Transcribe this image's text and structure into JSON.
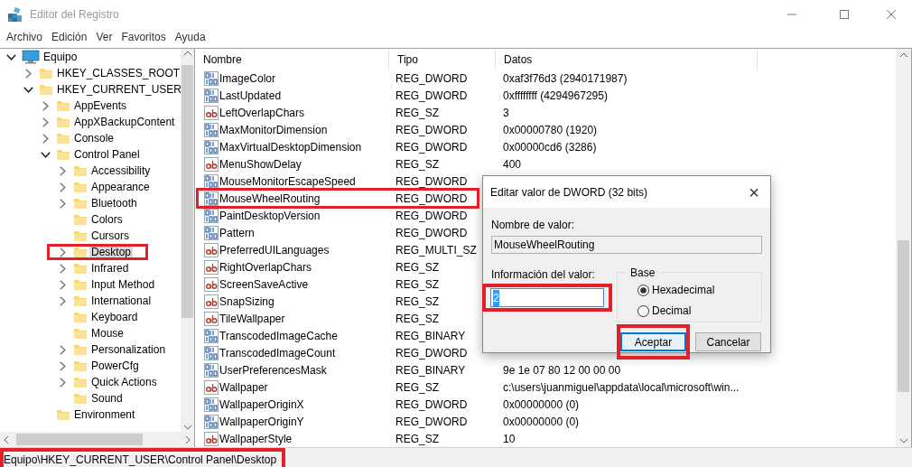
{
  "window": {
    "title": "Editor del Registro"
  },
  "menu": [
    "Archivo",
    "Edición",
    "Ver",
    "Favoritos",
    "Ayuda"
  ],
  "tree": [
    {
      "label": "Equipo",
      "kind": "computer",
      "expanded": true,
      "selected": false,
      "children": [
        {
          "label": "HKEY_CLASSES_ROOT",
          "kind": "branch",
          "expanded": false,
          "selected": false
        },
        {
          "label": "HKEY_CURRENT_USER",
          "kind": "branch",
          "expanded": true,
          "selected": false,
          "children": [
            {
              "label": "AppEvents",
              "kind": "branch",
              "expanded": false,
              "selected": false
            },
            {
              "label": "AppXBackupContent",
              "kind": "branch",
              "expanded": false,
              "selected": false
            },
            {
              "label": "Console",
              "kind": "branch",
              "expanded": false,
              "selected": false
            },
            {
              "label": "Control Panel",
              "kind": "branch",
              "expanded": true,
              "selected": false,
              "children": [
                {
                  "label": "Accessibility",
                  "kind": "branch",
                  "expanded": false,
                  "selected": false
                },
                {
                  "label": "Appearance",
                  "kind": "branch",
                  "expanded": false,
                  "selected": false
                },
                {
                  "label": "Bluetooth",
                  "kind": "branch",
                  "expanded": false,
                  "selected": false
                },
                {
                  "label": "Colors",
                  "kind": "leaf",
                  "selected": false
                },
                {
                  "label": "Cursors",
                  "kind": "leaf",
                  "selected": false
                },
                {
                  "label": "Desktop",
                  "kind": "branch",
                  "expanded": false,
                  "selected": true
                },
                {
                  "label": "Infrared",
                  "kind": "branch",
                  "expanded": false,
                  "selected": false
                },
                {
                  "label": "Input Method",
                  "kind": "branch",
                  "expanded": false,
                  "selected": false
                },
                {
                  "label": "International",
                  "kind": "branch",
                  "expanded": false,
                  "selected": false
                },
                {
                  "label": "Keyboard",
                  "kind": "leaf",
                  "selected": false
                },
                {
                  "label": "Mouse",
                  "kind": "leaf",
                  "selected": false
                },
                {
                  "label": "Personalization",
                  "kind": "branch",
                  "expanded": false,
                  "selected": false
                },
                {
                  "label": "PowerCfg",
                  "kind": "branch",
                  "expanded": false,
                  "selected": false
                },
                {
                  "label": "Quick Actions",
                  "kind": "branch",
                  "expanded": false,
                  "selected": false
                },
                {
                  "label": "Sound",
                  "kind": "leaf",
                  "selected": false
                }
              ]
            },
            {
              "label": "Environment",
              "kind": "leaf",
              "selected": false
            }
          ]
        }
      ]
    }
  ],
  "list": {
    "columns": [
      "Nombre",
      "Tipo",
      "Datos"
    ],
    "rows": [
      {
        "name": "ImageColor",
        "kind": "binary",
        "type": "REG_DWORD",
        "data": "0xaf3f76d3 (2940171987)"
      },
      {
        "name": "LastUpdated",
        "kind": "binary",
        "type": "REG_DWORD",
        "data": "0xffffffff (4294967295)"
      },
      {
        "name": "LeftOverlapChars",
        "kind": "string",
        "type": "REG_SZ",
        "data": "3"
      },
      {
        "name": "MaxMonitorDimension",
        "kind": "binary",
        "type": "REG_DWORD",
        "data": "0x00000780 (1920)"
      },
      {
        "name": "MaxVirtualDesktopDimension",
        "kind": "binary",
        "type": "REG_DWORD",
        "data": "0x00000cd6 (3286)"
      },
      {
        "name": "MenuShowDelay",
        "kind": "string",
        "type": "REG_SZ",
        "data": "400"
      },
      {
        "name": "MouseMonitorEscapeSpeed",
        "kind": "binary",
        "type": "REG_DWORD"
      },
      {
        "name": "MouseWheelRouting",
        "kind": "binary",
        "type": "REG_DWORD"
      },
      {
        "name": "PaintDesktopVersion",
        "kind": "binary",
        "type": "REG_DWORD"
      },
      {
        "name": "Pattern",
        "kind": "binary",
        "type": "REG_DWORD"
      },
      {
        "name": "PreferredUILanguages",
        "kind": "string",
        "type": "REG_MULTI_SZ"
      },
      {
        "name": "RightOverlapChars",
        "kind": "string",
        "type": "REG_SZ"
      },
      {
        "name": "ScreenSaveActive",
        "kind": "string",
        "type": "REG_SZ"
      },
      {
        "name": "SnapSizing",
        "kind": "string",
        "type": "REG_SZ"
      },
      {
        "name": "TileWallpaper",
        "kind": "string",
        "type": "REG_SZ"
      },
      {
        "name": "TranscodedImageCache",
        "kind": "binary",
        "type": "REG_BINARY"
      },
      {
        "name": "TranscodedImageCount",
        "kind": "binary",
        "type": "REG_DWORD"
      },
      {
        "name": "UserPreferencesMask",
        "kind": "binary",
        "type": "REG_BINARY",
        "data": "9e 1e 07 80 12 00 00 00"
      },
      {
        "name": "Wallpaper",
        "kind": "string",
        "type": "REG_SZ",
        "data": "c:\\users\\juanmiguel\\appdata\\local\\microsoft\\win..."
      },
      {
        "name": "WallpaperOriginX",
        "kind": "binary",
        "type": "REG_DWORD",
        "data": "0x00000000 (0)"
      },
      {
        "name": "WallpaperOriginY",
        "kind": "binary",
        "type": "REG_DWORD",
        "data": "0x00000000 (0)"
      },
      {
        "name": "WallpaperStyle",
        "kind": "string",
        "type": "REG_SZ",
        "data": "10"
      }
    ]
  },
  "dialog": {
    "title": "Editar valor de DWORD (32 bits)",
    "close": "×",
    "name_label": "Nombre de valor:",
    "name_value": "MouseWheelRouting",
    "value_label": "Información del valor:",
    "value": "2",
    "value_selected": true,
    "base_label": "Base",
    "radios": [
      {
        "label": "Hexadecimal",
        "selected": true
      },
      {
        "label": "Decimal",
        "selected": false
      }
    ],
    "buttons": [
      {
        "label": "Aceptar",
        "default": true
      },
      {
        "label": "Cancelar",
        "default": false
      }
    ]
  },
  "status_bar": "Equipo\\HKEY_CURRENT_USER\\Control Panel\\Desktop"
}
